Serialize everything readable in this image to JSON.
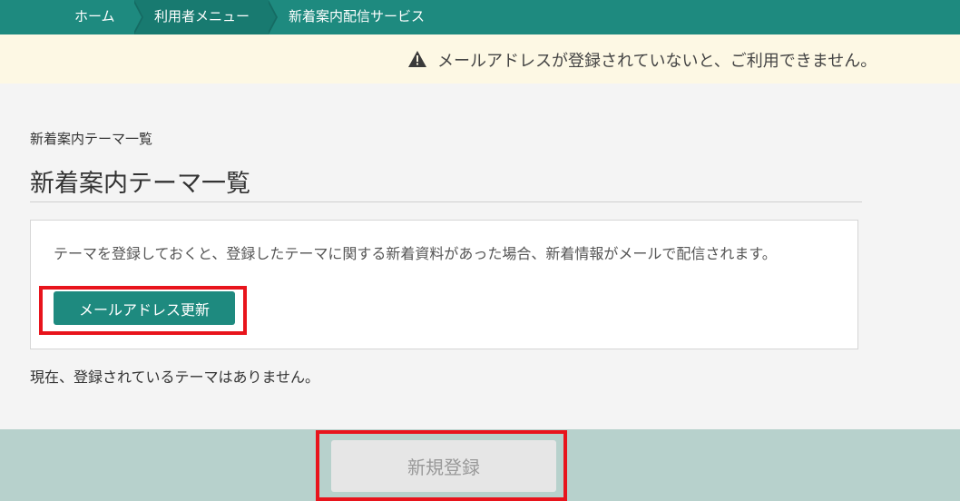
{
  "breadcrumb": {
    "items": [
      {
        "label": "ホーム"
      },
      {
        "label": "利用者メニュー"
      },
      {
        "label": "新着案内配信サービス"
      }
    ]
  },
  "warning": {
    "icon": "warning-triangle-icon",
    "text": "メールアドレスが登録されていないと、ご利用できません。"
  },
  "main": {
    "small_title": "新着案内テーマ一覧",
    "page_title": "新着案内テーマ一覧",
    "info_text": "テーマを登録しておくと、登録したテーマに関する新着資料があった場合、新着情報がメールで配信されます。",
    "mail_button_label": "メールアドレス更新",
    "status_text": "現在、登録されているテーマはありません。"
  },
  "footer": {
    "register_button_label": "新規登録"
  },
  "colors": {
    "primary": "#1e8a7f",
    "warning_bg": "#fdf8e4",
    "footer_bg": "#b7d1cc",
    "highlight": "#e8141c"
  }
}
